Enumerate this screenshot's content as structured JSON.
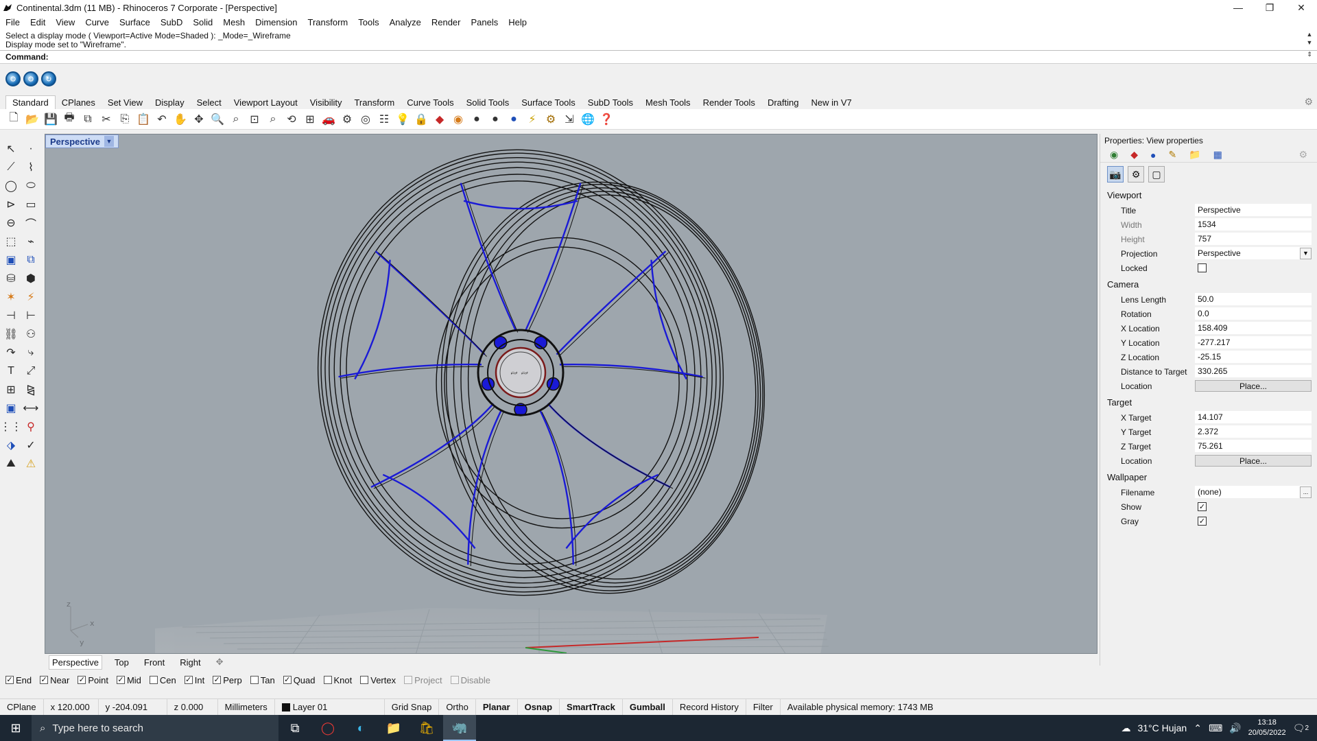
{
  "window": {
    "title": "Continental.3dm (11 MB) - Rhinoceros 7 Corporate - [Perspective]",
    "controls": [
      "—",
      "❐",
      "✕"
    ]
  },
  "menu": [
    "File",
    "Edit",
    "View",
    "Curve",
    "Surface",
    "SubD",
    "Solid",
    "Mesh",
    "Dimension",
    "Transform",
    "Tools",
    "Analyze",
    "Render",
    "Panels",
    "Help"
  ],
  "command": {
    "history": [
      "Select a display mode ( Viewport=Active  Mode=Shaded ): _Mode=_Wireframe",
      "Display mode set to \"Wireframe\"."
    ],
    "label": "Command:",
    "value": ""
  },
  "toolbar_tabs": {
    "items": [
      "Standard",
      "CPlanes",
      "Set View",
      "Display",
      "Select",
      "Viewport Layout",
      "Visibility",
      "Transform",
      "Curve Tools",
      "Solid Tools",
      "Surface Tools",
      "SubD Tools",
      "Mesh Tools",
      "Render Tools",
      "Drafting",
      "New in V7"
    ],
    "active": "Standard"
  },
  "viewport": {
    "title": "Perspective",
    "axis_x": "x",
    "axis_y": "y",
    "axis_z": "z",
    "wire_color": "#1a1ad6"
  },
  "viewport_tabs": [
    "Perspective",
    "Top",
    "Front",
    "Right"
  ],
  "osnaps": [
    {
      "label": "End",
      "checked": true,
      "enabled": true
    },
    {
      "label": "Near",
      "checked": true,
      "enabled": true
    },
    {
      "label": "Point",
      "checked": true,
      "enabled": true
    },
    {
      "label": "Mid",
      "checked": true,
      "enabled": true
    },
    {
      "label": "Cen",
      "checked": false,
      "enabled": true
    },
    {
      "label": "Int",
      "checked": true,
      "enabled": true
    },
    {
      "label": "Perp",
      "checked": true,
      "enabled": true
    },
    {
      "label": "Tan",
      "checked": false,
      "enabled": true
    },
    {
      "label": "Quad",
      "checked": true,
      "enabled": true
    },
    {
      "label": "Knot",
      "checked": false,
      "enabled": true
    },
    {
      "label": "Vertex",
      "checked": false,
      "enabled": true
    },
    {
      "label": "Project",
      "checked": false,
      "enabled": false
    },
    {
      "label": "Disable",
      "checked": false,
      "enabled": false
    }
  ],
  "status": {
    "cplane": "CPlane",
    "x": "x 120.000",
    "y": "y -204.091",
    "z": "z 0.000",
    "units": "Millimeters",
    "layer": "Layer 01",
    "toggles": [
      {
        "label": "Grid Snap",
        "bold": false
      },
      {
        "label": "Ortho",
        "bold": false
      },
      {
        "label": "Planar",
        "bold": true
      },
      {
        "label": "Osnap",
        "bold": true
      },
      {
        "label": "SmartTrack",
        "bold": true
      },
      {
        "label": "Gumball",
        "bold": true
      },
      {
        "label": "Record History",
        "bold": false
      },
      {
        "label": "Filter",
        "bold": false
      }
    ],
    "memory": "Available physical memory: 1743 MB"
  },
  "properties": {
    "header": "Properties: View properties",
    "sections": {
      "viewport": "Viewport",
      "camera": "Camera",
      "target": "Target",
      "wallpaper": "Wallpaper"
    },
    "viewport": {
      "title": {
        "label": "Title",
        "value": "Perspective"
      },
      "width": {
        "label": "Width",
        "value": "1534"
      },
      "height": {
        "label": "Height",
        "value": "757"
      },
      "projection": {
        "label": "Projection",
        "value": "Perspective"
      },
      "locked": {
        "label": "Locked",
        "checked": false
      }
    },
    "camera": {
      "lens": {
        "label": "Lens Length",
        "value": "50.0"
      },
      "rotation": {
        "label": "Rotation",
        "value": "0.0"
      },
      "xloc": {
        "label": "X Location",
        "value": "158.409"
      },
      "yloc": {
        "label": "Y Location",
        "value": "-277.217"
      },
      "zloc": {
        "label": "Z Location",
        "value": "-25.15"
      },
      "dist": {
        "label": "Distance to Target",
        "value": "330.265"
      },
      "location": {
        "label": "Location",
        "button": "Place..."
      }
    },
    "target": {
      "x": {
        "label": "X Target",
        "value": "14.107"
      },
      "y": {
        "label": "Y Target",
        "value": "2.372"
      },
      "z": {
        "label": "Z Target",
        "value": "75.261"
      },
      "location": {
        "label": "Location",
        "button": "Place..."
      }
    },
    "wallpaper": {
      "filename": {
        "label": "Filename",
        "value": "(none)",
        "button": "..."
      },
      "show": {
        "label": "Show",
        "checked": true
      },
      "gray": {
        "label": "Gray",
        "checked": true
      }
    }
  },
  "taskbar": {
    "search_placeholder": "Type here to search",
    "weather": "31°C  Hujan",
    "time": "13:18",
    "date": "20/05/2022",
    "notifications": "2"
  }
}
